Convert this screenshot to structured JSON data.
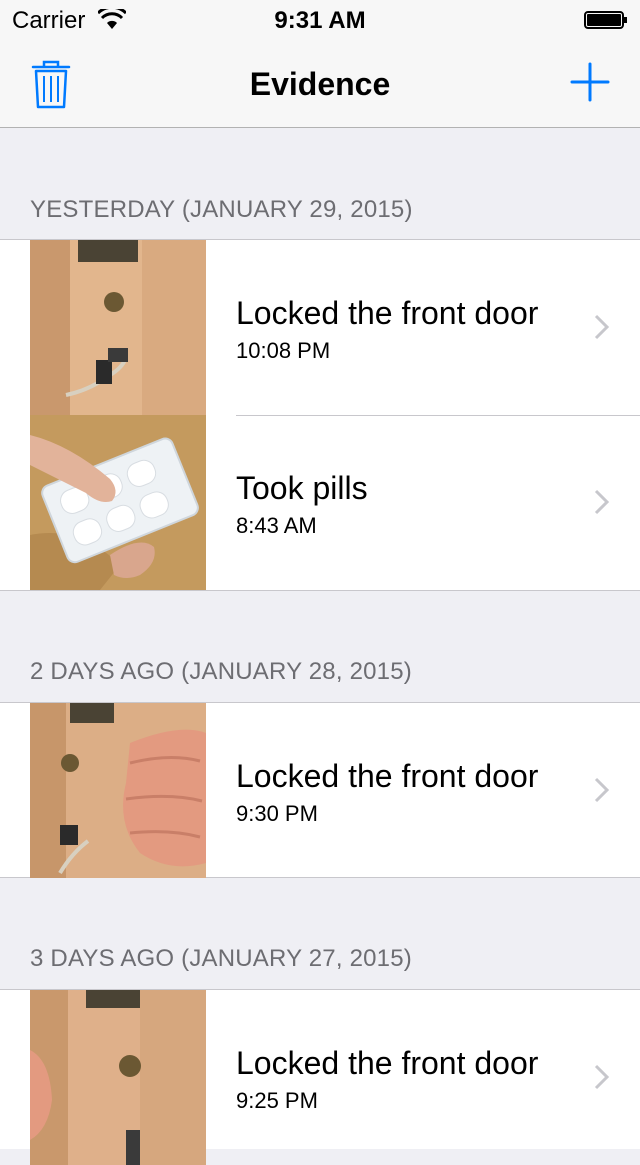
{
  "status_bar": {
    "carrier": "Carrier",
    "time": "9:31 AM"
  },
  "nav": {
    "title": "Evidence",
    "trash_icon": "trash-icon",
    "add_icon": "plus-icon"
  },
  "sections": [
    {
      "header": "YESTERDAY (JANUARY 29, 2015)",
      "items": [
        {
          "title": "Locked the front door",
          "time": "10:08 PM"
        },
        {
          "title": "Took pills",
          "time": "8:43 AM"
        }
      ]
    },
    {
      "header": "2 DAYS AGO (JANUARY 28, 2015)",
      "items": [
        {
          "title": "Locked the front door",
          "time": "9:30 PM"
        }
      ]
    },
    {
      "header": "3 DAYS AGO (JANUARY 27, 2015)",
      "items": [
        {
          "title": "Locked the front door",
          "time": "9:25 PM"
        }
      ]
    }
  ],
  "colors": {
    "tint": "#007aff",
    "background": "#efeff4",
    "header_text": "#6d6d72"
  }
}
